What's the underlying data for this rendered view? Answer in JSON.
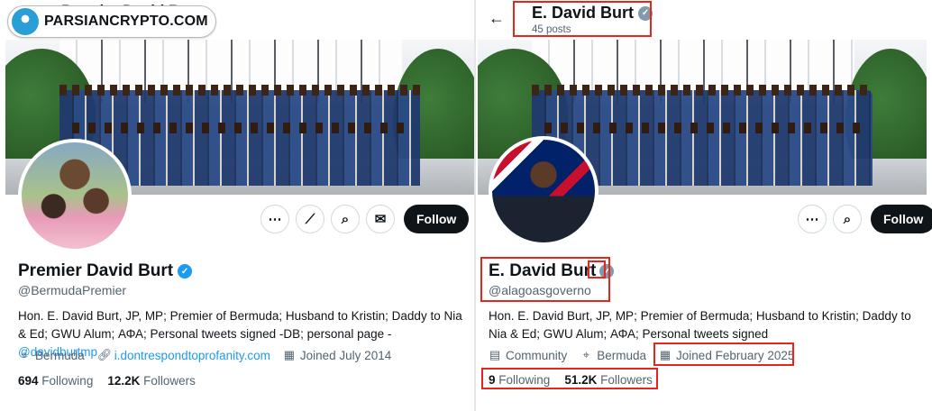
{
  "watermark": {
    "text": "PARSIANCRYPTO.COM"
  },
  "left": {
    "top_name": "Premier David Burt",
    "name": "Premier David Burt",
    "handle": "@BermudaPremier",
    "bio_text": "Hon. E. David Burt, JP, MP; Premier of Bermuda; Husband to Kristin; Daddy to Nia & Ed; GWU Alum; ΑΦΑ; Personal tweets signed -DB; personal page - ",
    "bio_link": "@davidburtmp",
    "location": "Bermuda",
    "website": "i.dontrespondtoprofanity.com",
    "joined": "Joined July 2014",
    "following_count": "694",
    "following_label": "Following",
    "followers_count": "12.2K",
    "followers_label": "Followers",
    "follow_label": "Follow"
  },
  "right": {
    "back_icon": "arrow-left-icon",
    "top_name": "E. David Burt",
    "posts": "45 posts",
    "name": "E. David Burt",
    "handle": "@alagoasgoverno",
    "bio_text": "Hon. E. David Burt, JP, MP; Premier of Bermuda; Husband to Kristin; Daddy to Nia & Ed; GWU Alum; ΑΦΑ; Personal tweets signed",
    "category": "Community",
    "location": "Bermuda",
    "joined": "Joined February 2025",
    "following_count": "9",
    "following_label": "Following",
    "followers_count": "51.2K",
    "followers_label": "Followers",
    "follow_label": "Follow"
  },
  "colors": {
    "accent": "#1d9bf0",
    "highlight": "#e5261d",
    "verified_grey": "#829aab"
  }
}
